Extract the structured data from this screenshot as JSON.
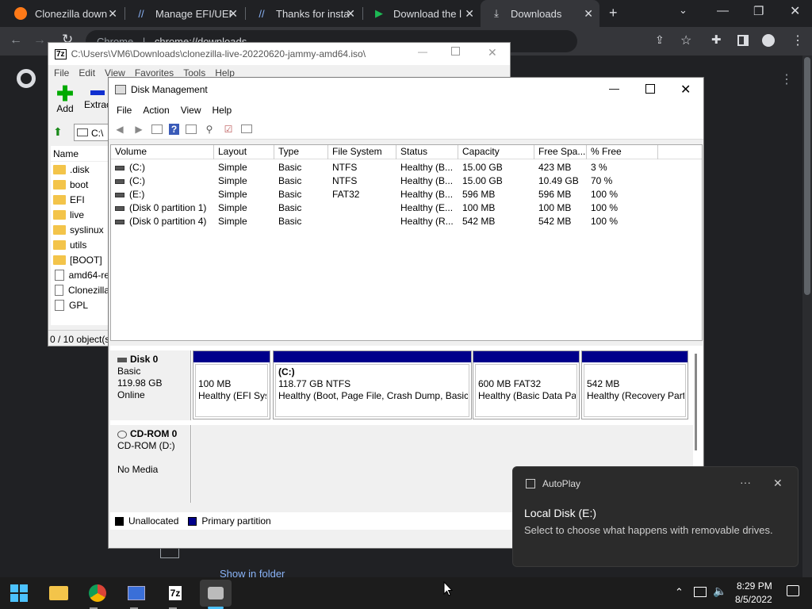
{
  "chrome": {
    "tabs": [
      {
        "title": "Clonezilla down",
        "icon": "firefox-icon"
      },
      {
        "title": "Manage EFI/UEF",
        "icon": "site-icon"
      },
      {
        "title": "Thanks for insta",
        "icon": "site-icon"
      },
      {
        "title": "Download the l",
        "icon": "play-icon"
      },
      {
        "title": "Downloads",
        "icon": "download-icon"
      }
    ],
    "address_prefix": "Chrome",
    "address": "chrome://downloads",
    "show_in_folder": "Show in folder"
  },
  "zip": {
    "title": "C:\\Users\\VM6\\Downloads\\clonezilla-live-20220620-jammy-amd64.iso\\",
    "menu": [
      "File",
      "Edit",
      "View",
      "Favorites",
      "Tools",
      "Help"
    ],
    "add_label": "Add",
    "extract_label": "Extrac",
    "path": "C:\\",
    "column_name": "Name",
    "items": [
      {
        "name": ".disk",
        "type": "folder"
      },
      {
        "name": "boot",
        "type": "folder"
      },
      {
        "name": "EFI",
        "type": "folder"
      },
      {
        "name": "live",
        "type": "folder"
      },
      {
        "name": "syslinux",
        "type": "folder"
      },
      {
        "name": "utils",
        "type": "folder"
      },
      {
        "name": "[BOOT]",
        "type": "folder"
      },
      {
        "name": "amd64-re",
        "type": "file"
      },
      {
        "name": "Clonezilla",
        "type": "file"
      },
      {
        "name": "GPL",
        "type": "file"
      }
    ],
    "status": "0 / 10 object(s"
  },
  "dm": {
    "title": "Disk Management",
    "menu": [
      "File",
      "Action",
      "View",
      "Help"
    ],
    "columns": [
      "Volume",
      "Layout",
      "Type",
      "File System",
      "Status",
      "Capacity",
      "Free Spa...",
      "% Free"
    ],
    "volumes": [
      [
        "(C:)",
        "Simple",
        "Basic",
        "NTFS",
        "Healthy (B...",
        "15.00 GB",
        "423 MB",
        "3 %"
      ],
      [
        "(C:)",
        "Simple",
        "Basic",
        "NTFS",
        "Healthy (B...",
        "15.00 GB",
        "10.49 GB",
        "70 %"
      ],
      [
        "(E:)",
        "Simple",
        "Basic",
        "FAT32",
        "Healthy (B...",
        "596 MB",
        "596 MB",
        "100 %"
      ],
      [
        "(Disk 0 partition 1)",
        "Simple",
        "Basic",
        "",
        "Healthy (E...",
        "100 MB",
        "100 MB",
        "100 %"
      ],
      [
        "(Disk 0 partition 4)",
        "Simple",
        "Basic",
        "",
        "Healthy (R...",
        "542 MB",
        "542 MB",
        "100 %"
      ]
    ],
    "disk0": {
      "name": "Disk 0",
      "type": "Basic",
      "size": "119.98 GB",
      "state": "Online"
    },
    "partitions": [
      {
        "letter": "",
        "size": "100 MB",
        "status": "Healthy (EFI Sys"
      },
      {
        "letter": "(C:)",
        "size": "118.77 GB NTFS",
        "status": "Healthy (Boot, Page File, Crash Dump, Basic I"
      },
      {
        "letter": "",
        "size": "600 MB FAT32",
        "status": "Healthy (Basic Data Par"
      },
      {
        "letter": "",
        "size": "542 MB",
        "status": "Healthy (Recovery Part"
      }
    ],
    "cdrom": {
      "name": "CD-ROM 0",
      "type": "CD-ROM (D:)",
      "media": "No Media"
    },
    "legend": {
      "unallocated": "Unallocated",
      "primary": "Primary partition"
    },
    "colors": {
      "primary": "#00008b",
      "unallocated": "#000000"
    }
  },
  "autoplay": {
    "app": "AutoPlay",
    "title": "Local Disk (E:)",
    "body": "Select to choose what happens with removable drives."
  },
  "taskbar": {
    "time": "8:29 PM",
    "date": "8/5/2022"
  }
}
